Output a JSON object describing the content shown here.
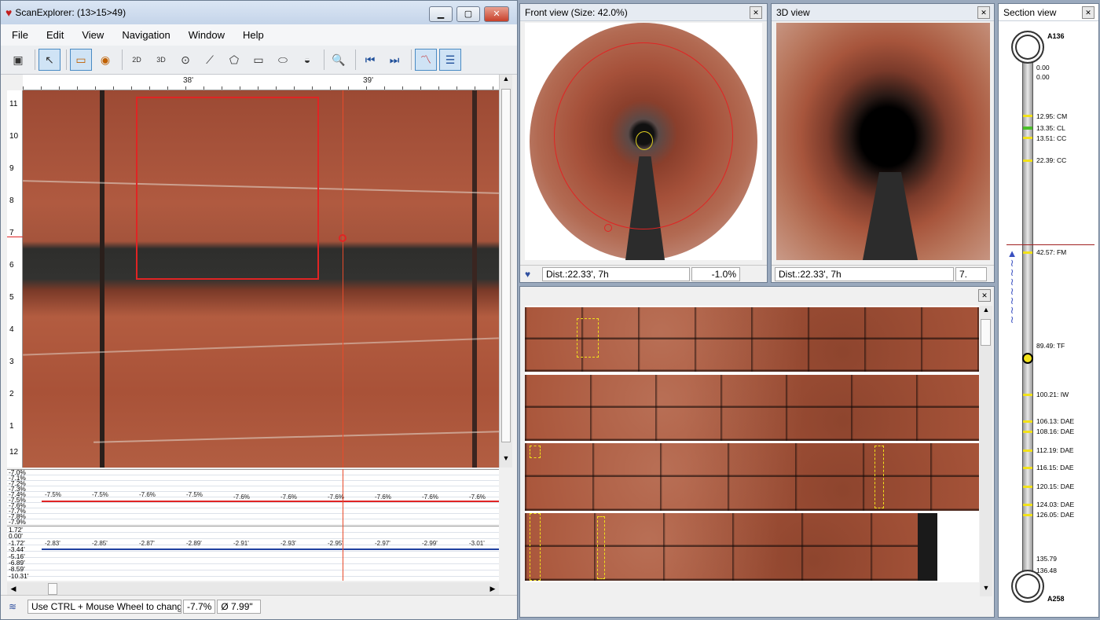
{
  "main_window": {
    "title": "ScanExplorer:  (13>15>49)",
    "menu": [
      "File",
      "Edit",
      "View",
      "Navigation",
      "Window",
      "Help"
    ],
    "ruler_labels": [
      "38'",
      "39'"
    ],
    "y_labels": [
      "11",
      "10",
      "9",
      "8",
      "7",
      "6",
      "5",
      "4",
      "3",
      "2",
      "1",
      "12"
    ],
    "graph1_axis": [
      "-7.0%",
      "-7.1%",
      "-7.2%",
      "-7.3%",
      "-7.4%",
      "-7.5%",
      "-7.6%",
      "-7.7%",
      "-7.8%",
      "-7.9%"
    ],
    "graph1_values": [
      "-7.5%",
      "-7.5%",
      "-7.6%",
      "-7.5%",
      "-7.6%",
      "-7.6%",
      "-7.6%",
      "-7.6%",
      "-7.6%",
      "-7.6%"
    ],
    "graph2_axis": [
      "1.72'",
      "0.00'",
      "-1.72'",
      "-3.44'",
      "-5.16'",
      "-6.89'",
      "-8.59'",
      "-10.31'"
    ],
    "graph2_values": [
      "-2.83'",
      "-2.85'",
      "-2.87'",
      "-2.89'",
      "-2.91'",
      "-2.93'",
      "-2.95'",
      "-2.97'",
      "-2.99'",
      "-3.01'"
    ],
    "status_hint": "Use CTRL + Mouse Wheel to change",
    "status_percent": "-7.7%",
    "status_diameter": "Ø 7.99\""
  },
  "front_view": {
    "title": "Front view (Size: 42.0%)",
    "dist": "Dist.:22.33', 7h",
    "value": "-1.0%"
  },
  "view3d": {
    "title": "3D view",
    "dist": "Dist.:22.33', 7h",
    "value": "7."
  },
  "section_view": {
    "title": "Section view",
    "top_label": "A136",
    "bottom_label": "A258",
    "markers": [
      "0.00",
      "0.00",
      "12.95: CM",
      "13.35: CL",
      "13.51: CC",
      "22.39: CC",
      "42.57: FM",
      "89.49: TF",
      "100.21: IW",
      "106.13: DAE",
      "108.16: DAE",
      "112.19: DAE",
      "116.15: DAE",
      "120.15: DAE",
      "124.03: DAE",
      "126.05: DAE",
      "135.79",
      "136.48"
    ]
  },
  "colors": {
    "accent_red": "#e02424",
    "line_blue": "#2040a0",
    "marker_yellow": "#f2e21a"
  }
}
